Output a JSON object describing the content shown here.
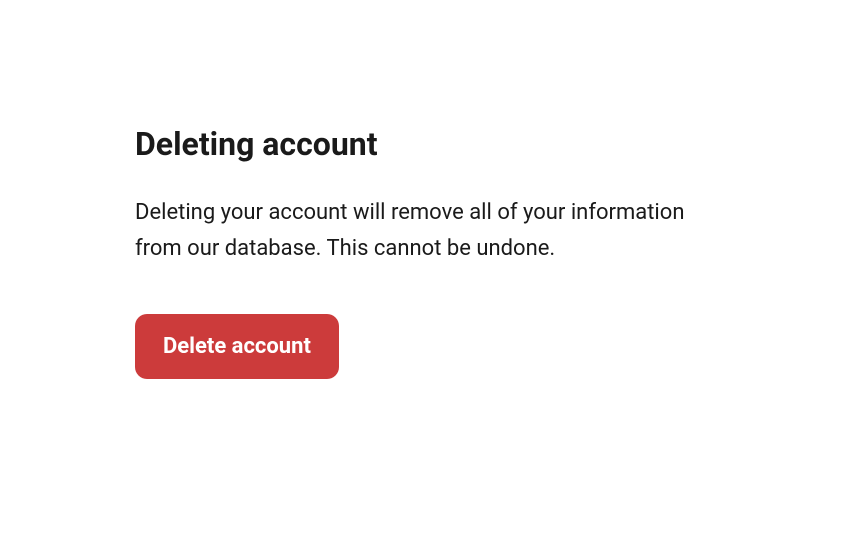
{
  "section": {
    "heading": "Deleting account",
    "description": "Deleting your account will remove all of your information from our database. This cannot be undone.",
    "button_label": "Delete account"
  },
  "colors": {
    "danger": "#CC3B3B",
    "text": "#1a1a1a"
  }
}
